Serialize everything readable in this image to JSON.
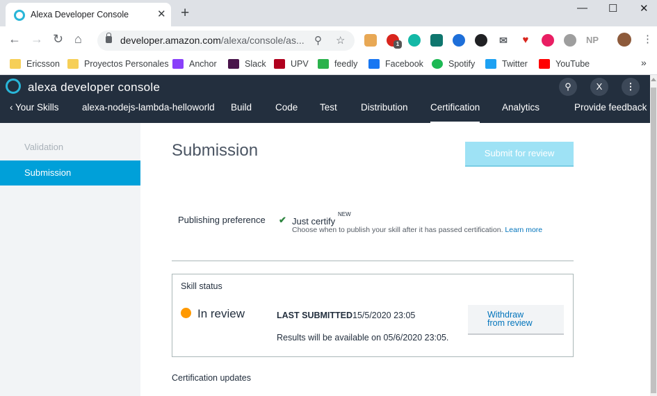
{
  "browser": {
    "tab_title": "Alexa Developer Console",
    "tab_close": "✕",
    "new_tab": "+",
    "url_host": "developer.amazon.com",
    "url_path": "/alexa/console/as...",
    "window_minimize": "—",
    "window_maximize": "☐",
    "window_close": "✕",
    "profile_badge": "NP",
    "extension_count": "1"
  },
  "bookmarks": [
    {
      "label": "Ericsson",
      "color": "#f6cf57"
    },
    {
      "label": "Proyectos Personales",
      "color": "#f6cf57"
    },
    {
      "label": "Anchor",
      "color": "#8940fa"
    },
    {
      "label": "Slack",
      "color": "#4a154b"
    },
    {
      "label": "UPV",
      "color": "#b0001e"
    },
    {
      "label": "feedly",
      "color": "#2bb24c"
    },
    {
      "label": "Facebook",
      "color": "#1877f2"
    },
    {
      "label": "Spotify",
      "color": "#1db954"
    },
    {
      "label": "Twitter",
      "color": "#1da1f2"
    },
    {
      "label": "YouTube",
      "color": "#ff0000"
    }
  ],
  "bookmarks_more": "»",
  "header": {
    "title": "alexa developer console",
    "close_avatar": "X"
  },
  "nav": {
    "back": "‹ Your Skills",
    "skill_name": "alexa-nodejs-lambda-helloworld",
    "build": "Build",
    "code": "Code",
    "test": "Test",
    "distribution": "Distribution",
    "certification": "Certification",
    "analytics": "Analytics",
    "feedback": "Provide feedback"
  },
  "sidebar": {
    "validation": "Validation",
    "submission": "Submission"
  },
  "main": {
    "title": "Submission",
    "submit_button": "Submit for review",
    "publishing_label": "Publishing preference",
    "publishing_option": "Just certify",
    "new_badge": "NEW",
    "publishing_desc": "Choose when to publish your skill after it has passed certification.",
    "learn_more": "Learn more",
    "status_label": "Skill status",
    "status": "In review",
    "last_submitted_label": "LAST SUBMITTED",
    "last_submitted_value": "15/5/2020 23:05",
    "results_text": "Results will be available on 05/6/2020 23:05.",
    "withdraw_line1": "Withdraw",
    "withdraw_line2": "from review",
    "cert_updates": "Certification updates"
  },
  "colors": {
    "header_bg": "#232f3e",
    "accent": "#00a0d9",
    "status_dot": "#ff9900",
    "link": "#0073bb"
  }
}
